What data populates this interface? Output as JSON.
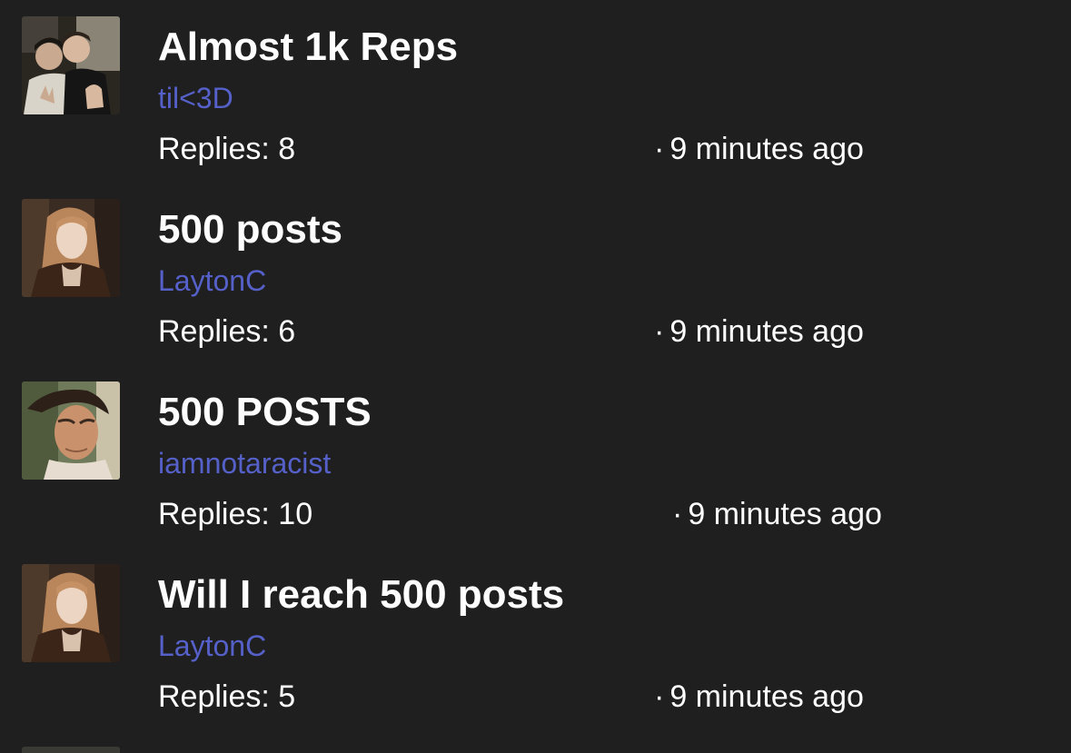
{
  "threads": [
    {
      "title": "Almost 1k Reps",
      "author": "til<3D",
      "replies": "Replies: 8",
      "time": "9 minutes ago",
      "avatar_icon": "two-people-photo-avatar"
    },
    {
      "title": "500 posts",
      "author": "LaytonC",
      "replies": "Replies: 6",
      "time": "9 minutes ago",
      "avatar_icon": "woman-photo-avatar"
    },
    {
      "title": "500 POSTS",
      "author": "iamnotaracist",
      "replies": "Replies: 10",
      "time": "9 minutes ago",
      "avatar_icon": "man-photo-avatar"
    },
    {
      "title": "Will I reach 500 posts",
      "author": "LaytonC",
      "replies": "Replies: 5",
      "time": "9 minutes ago",
      "avatar_icon": "woman-photo-avatar"
    }
  ],
  "separator": "·",
  "colors": {
    "background": "#1f1f20",
    "title": "#ffffff",
    "author_link": "#5561c9",
    "meta_text": "#ffffff"
  }
}
